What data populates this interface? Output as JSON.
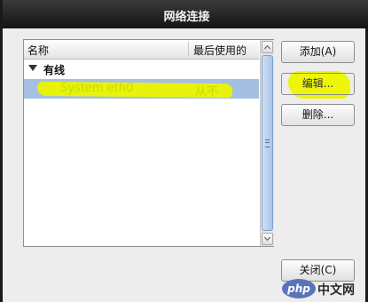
{
  "window": {
    "title": "网络连接"
  },
  "list": {
    "columns": {
      "name": "名称",
      "last_used": "最后使用的"
    },
    "groups": [
      {
        "label": "有线",
        "expanded": true,
        "rows": [
          {
            "name": "System eth0",
            "last_used": "从不",
            "selected": true
          }
        ]
      }
    ]
  },
  "buttons": {
    "add": "添加(A)",
    "edit": "编辑...",
    "delete": "删除...",
    "close": "关闭(C)"
  },
  "watermark": {
    "logo": "php",
    "text": "中文网"
  },
  "colors": {
    "titlebar": "#1e1e1e",
    "selection": "#a5bfe0",
    "highlighter": "#e8f20a"
  }
}
